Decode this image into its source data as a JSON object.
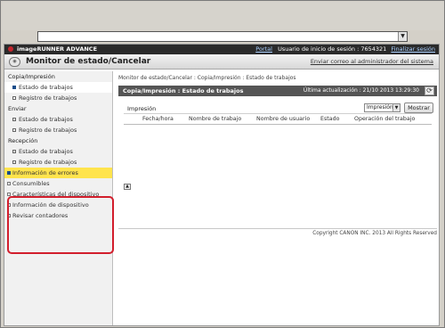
{
  "browser": {
    "dropdown_glyph": "▼"
  },
  "header": {
    "brand": "imageRUNNER ADVANCE",
    "portal": "Portal",
    "login_label": "Usuario de inicio de sesión : 7654321",
    "logout": "Finalizar sesión"
  },
  "titlebar": {
    "title": "Monitor de estado/Cancelar",
    "mail_admin": "Enviar correo al administrador del sistema"
  },
  "sidebar": {
    "copy_section": "Copia/Impresión",
    "copy_items": [
      "Estado de trabajos",
      "Registro de trabajos"
    ],
    "send_section": "Enviar",
    "send_items": [
      "Estado de trabajos",
      "Registro de trabajos"
    ],
    "receive_section": "Recepción",
    "receive_items": [
      "Estado de trabajos",
      "Registro de trabajos"
    ],
    "other_items": [
      "Información de errores",
      "Consumibles",
      "Características del dispositivo",
      "Información de dispositivo",
      "Revisar contadores"
    ]
  },
  "main": {
    "breadcrumb": "Monitor de estado/Cancelar : Copia/Impresión : Estado de trabajos",
    "panel_title": "Copia/Impresión : Estado de trabajos",
    "last_update": "Última actualización : 21/10 2013 13:29:30",
    "filter_label": "Impresión",
    "filter_value": "Impresión",
    "show_button": "Mostrar",
    "columns": [
      "Fecha/hora",
      "Nombre de trabajo",
      "Nombre de usuario",
      "Estado",
      "Operación del trabajo"
    ]
  },
  "footer": {
    "copyright": "Copyright CANON INC. 2013 All Rights Reserved"
  }
}
